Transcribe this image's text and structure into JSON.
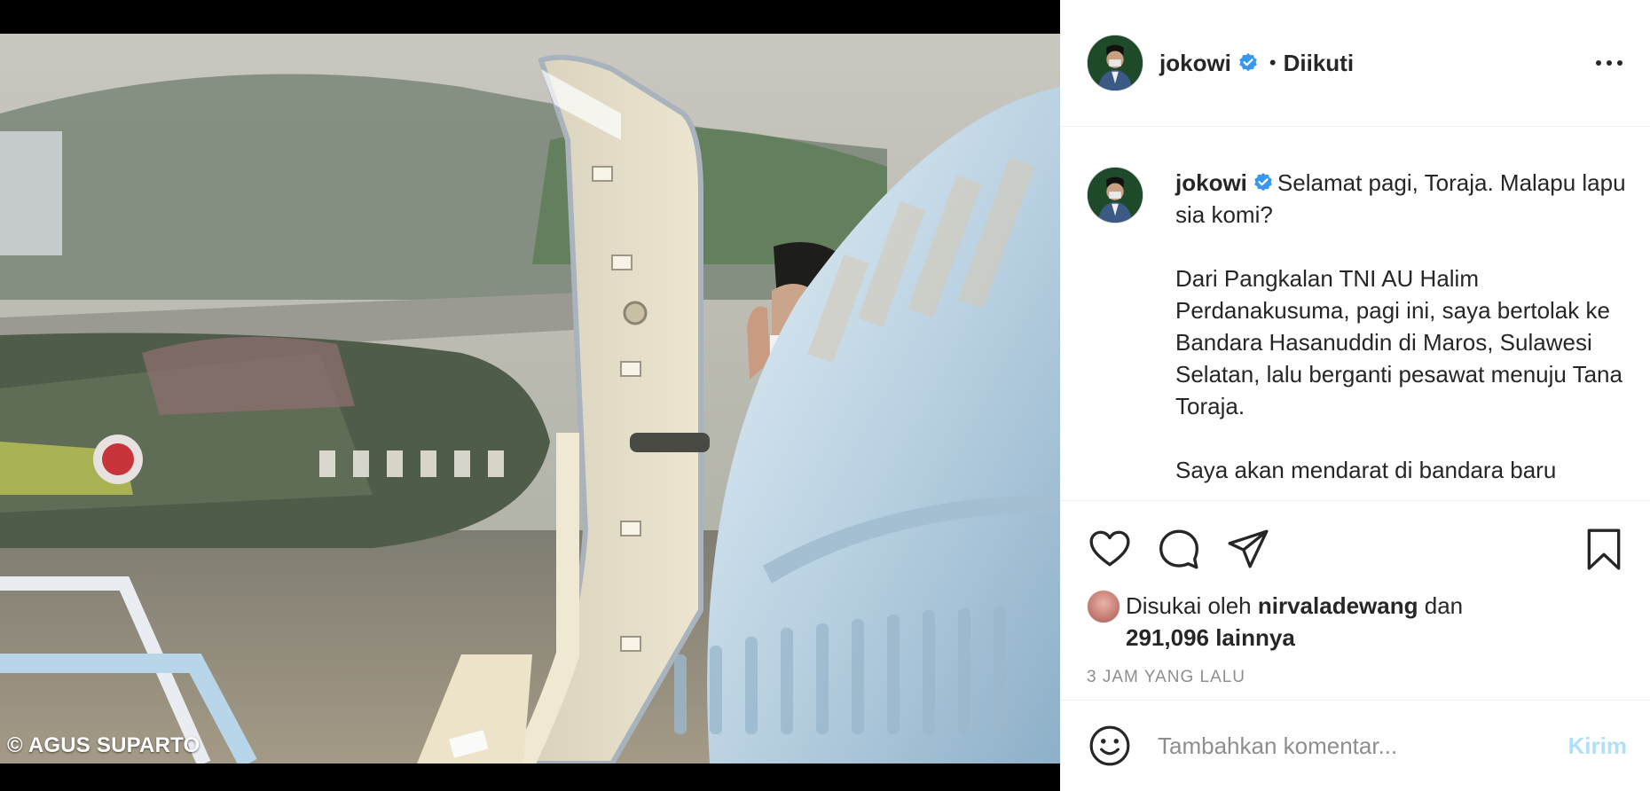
{
  "photo": {
    "credit": "© AGUS SUPARTO",
    "alt_subject": "airplane-door-wave"
  },
  "header": {
    "username": "jokowi",
    "separator": "•",
    "follow_state": "Diikuti"
  },
  "caption": {
    "username": "jokowi",
    "first_line": "Selamat pagi, Toraja. Malapu lapu sia komi?",
    "paragraph_2": "Dari Pangkalan TNI AU Halim Perdanakusuma, pagi ini, saya bertolak ke Bandara Hasanuddin di Maros, Sulawesi Selatan, lalu berganti pesawat menuju Tana Toraja.",
    "paragraph_3": "Saya akan mendarat di bandara baru"
  },
  "likes": {
    "prefix": "Disukai oleh",
    "liker": "nirvaladewang",
    "conjunction": "dan",
    "others": "291,096 lainnya"
  },
  "timestamp": "3 JAM YANG LALU",
  "comment": {
    "placeholder": "Tambahkan komentar...",
    "send_label": "Kirim"
  },
  "colors": {
    "verified": "#3897f0",
    "send_disabled": "#b2dffc",
    "muted": "#8e8e8e",
    "text": "#262626"
  }
}
